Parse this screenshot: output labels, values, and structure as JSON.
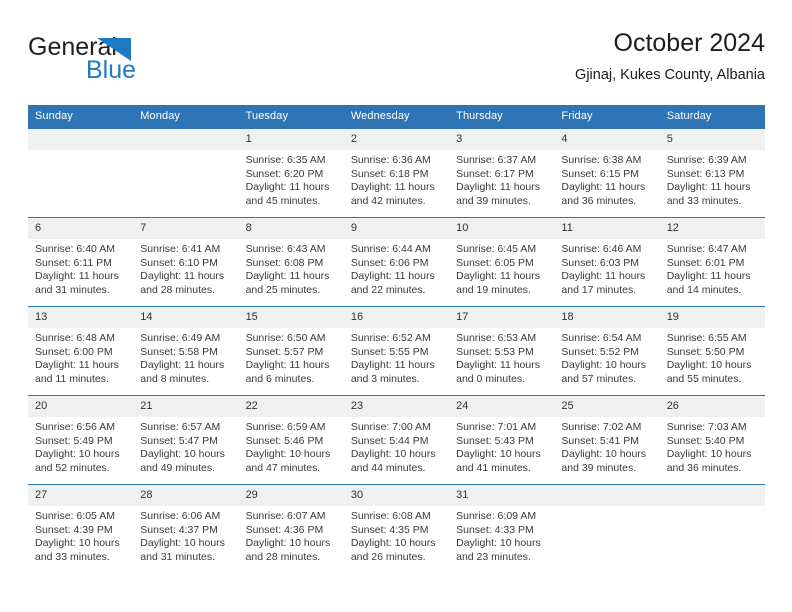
{
  "brand": {
    "name_line1": "General",
    "name_line2": "Blue",
    "triangle_icon": "brand-triangle-icon",
    "color_dark": "#231f20",
    "color_blue": "#1f7ac2"
  },
  "header": {
    "title": "October 2024",
    "subtitle": "Gjinaj, Kukes County, Albania"
  },
  "calendar": {
    "accent_color": "#2f74b5",
    "daynum_band_color": "#f0f0f0",
    "weekdays": [
      "Sunday",
      "Monday",
      "Tuesday",
      "Wednesday",
      "Thursday",
      "Friday",
      "Saturday"
    ],
    "weeks": [
      [
        {
          "day": "",
          "empty": true
        },
        {
          "day": "",
          "empty": true
        },
        {
          "day": "1",
          "sunrise": "Sunrise: 6:35 AM",
          "sunset": "Sunset: 6:20 PM",
          "daylight": "Daylight: 11 hours and 45 minutes."
        },
        {
          "day": "2",
          "sunrise": "Sunrise: 6:36 AM",
          "sunset": "Sunset: 6:18 PM",
          "daylight": "Daylight: 11 hours and 42 minutes."
        },
        {
          "day": "3",
          "sunrise": "Sunrise: 6:37 AM",
          "sunset": "Sunset: 6:17 PM",
          "daylight": "Daylight: 11 hours and 39 minutes."
        },
        {
          "day": "4",
          "sunrise": "Sunrise: 6:38 AM",
          "sunset": "Sunset: 6:15 PM",
          "daylight": "Daylight: 11 hours and 36 minutes."
        },
        {
          "day": "5",
          "sunrise": "Sunrise: 6:39 AM",
          "sunset": "Sunset: 6:13 PM",
          "daylight": "Daylight: 11 hours and 33 minutes."
        }
      ],
      [
        {
          "day": "6",
          "sunrise": "Sunrise: 6:40 AM",
          "sunset": "Sunset: 6:11 PM",
          "daylight": "Daylight: 11 hours and 31 minutes."
        },
        {
          "day": "7",
          "sunrise": "Sunrise: 6:41 AM",
          "sunset": "Sunset: 6:10 PM",
          "daylight": "Daylight: 11 hours and 28 minutes."
        },
        {
          "day": "8",
          "sunrise": "Sunrise: 6:43 AM",
          "sunset": "Sunset: 6:08 PM",
          "daylight": "Daylight: 11 hours and 25 minutes."
        },
        {
          "day": "9",
          "sunrise": "Sunrise: 6:44 AM",
          "sunset": "Sunset: 6:06 PM",
          "daylight": "Daylight: 11 hours and 22 minutes."
        },
        {
          "day": "10",
          "sunrise": "Sunrise: 6:45 AM",
          "sunset": "Sunset: 6:05 PM",
          "daylight": "Daylight: 11 hours and 19 minutes."
        },
        {
          "day": "11",
          "sunrise": "Sunrise: 6:46 AM",
          "sunset": "Sunset: 6:03 PM",
          "daylight": "Daylight: 11 hours and 17 minutes."
        },
        {
          "day": "12",
          "sunrise": "Sunrise: 6:47 AM",
          "sunset": "Sunset: 6:01 PM",
          "daylight": "Daylight: 11 hours and 14 minutes."
        }
      ],
      [
        {
          "day": "13",
          "sunrise": "Sunrise: 6:48 AM",
          "sunset": "Sunset: 6:00 PM",
          "daylight": "Daylight: 11 hours and 11 minutes."
        },
        {
          "day": "14",
          "sunrise": "Sunrise: 6:49 AM",
          "sunset": "Sunset: 5:58 PM",
          "daylight": "Daylight: 11 hours and 8 minutes."
        },
        {
          "day": "15",
          "sunrise": "Sunrise: 6:50 AM",
          "sunset": "Sunset: 5:57 PM",
          "daylight": "Daylight: 11 hours and 6 minutes."
        },
        {
          "day": "16",
          "sunrise": "Sunrise: 6:52 AM",
          "sunset": "Sunset: 5:55 PM",
          "daylight": "Daylight: 11 hours and 3 minutes."
        },
        {
          "day": "17",
          "sunrise": "Sunrise: 6:53 AM",
          "sunset": "Sunset: 5:53 PM",
          "daylight": "Daylight: 11 hours and 0 minutes."
        },
        {
          "day": "18",
          "sunrise": "Sunrise: 6:54 AM",
          "sunset": "Sunset: 5:52 PM",
          "daylight": "Daylight: 10 hours and 57 minutes."
        },
        {
          "day": "19",
          "sunrise": "Sunrise: 6:55 AM",
          "sunset": "Sunset: 5:50 PM",
          "daylight": "Daylight: 10 hours and 55 minutes."
        }
      ],
      [
        {
          "day": "20",
          "sunrise": "Sunrise: 6:56 AM",
          "sunset": "Sunset: 5:49 PM",
          "daylight": "Daylight: 10 hours and 52 minutes."
        },
        {
          "day": "21",
          "sunrise": "Sunrise: 6:57 AM",
          "sunset": "Sunset: 5:47 PM",
          "daylight": "Daylight: 10 hours and 49 minutes."
        },
        {
          "day": "22",
          "sunrise": "Sunrise: 6:59 AM",
          "sunset": "Sunset: 5:46 PM",
          "daylight": "Daylight: 10 hours and 47 minutes."
        },
        {
          "day": "23",
          "sunrise": "Sunrise: 7:00 AM",
          "sunset": "Sunset: 5:44 PM",
          "daylight": "Daylight: 10 hours and 44 minutes."
        },
        {
          "day": "24",
          "sunrise": "Sunrise: 7:01 AM",
          "sunset": "Sunset: 5:43 PM",
          "daylight": "Daylight: 10 hours and 41 minutes."
        },
        {
          "day": "25",
          "sunrise": "Sunrise: 7:02 AM",
          "sunset": "Sunset: 5:41 PM",
          "daylight": "Daylight: 10 hours and 39 minutes."
        },
        {
          "day": "26",
          "sunrise": "Sunrise: 7:03 AM",
          "sunset": "Sunset: 5:40 PM",
          "daylight": "Daylight: 10 hours and 36 minutes."
        }
      ],
      [
        {
          "day": "27",
          "sunrise": "Sunrise: 6:05 AM",
          "sunset": "Sunset: 4:39 PM",
          "daylight": "Daylight: 10 hours and 33 minutes."
        },
        {
          "day": "28",
          "sunrise": "Sunrise: 6:06 AM",
          "sunset": "Sunset: 4:37 PM",
          "daylight": "Daylight: 10 hours and 31 minutes."
        },
        {
          "day": "29",
          "sunrise": "Sunrise: 6:07 AM",
          "sunset": "Sunset: 4:36 PM",
          "daylight": "Daylight: 10 hours and 28 minutes."
        },
        {
          "day": "30",
          "sunrise": "Sunrise: 6:08 AM",
          "sunset": "Sunset: 4:35 PM",
          "daylight": "Daylight: 10 hours and 26 minutes."
        },
        {
          "day": "31",
          "sunrise": "Sunrise: 6:09 AM",
          "sunset": "Sunset: 4:33 PM",
          "daylight": "Daylight: 10 hours and 23 minutes."
        },
        {
          "day": "",
          "empty": true
        },
        {
          "day": "",
          "empty": true
        }
      ]
    ]
  }
}
